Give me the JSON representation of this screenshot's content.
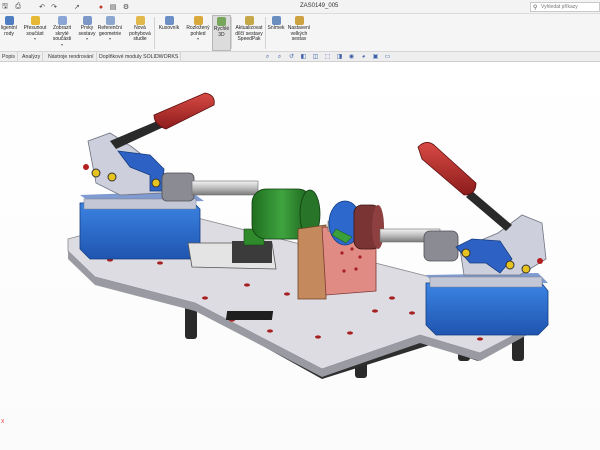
{
  "window": {
    "title": "ZAS0149_005",
    "search_placeholder": "Vyhledat příkazy"
  },
  "quick_access": [
    {
      "name": "save-icon",
      "glyph": "🖫"
    },
    {
      "name": "print-icon",
      "glyph": "⎙"
    },
    {
      "name": "undo-icon",
      "glyph": "↶"
    },
    {
      "name": "redo-icon",
      "glyph": "↷"
    },
    {
      "name": "select-arrow-icon",
      "glyph": "➚"
    },
    {
      "name": "rebuild-icon",
      "glyph": "●"
    },
    {
      "name": "file-properties-icon",
      "glyph": "▤"
    },
    {
      "name": "options-gear-icon",
      "glyph": "⚙"
    }
  ],
  "ribbon": {
    "buttons": [
      {
        "id": "smart-fasteners",
        "label": "ligentní\nrody",
        "icon_color": "#4f7fc0"
      },
      {
        "id": "move-component",
        "label": "Přesunout\nsoučást",
        "icon_color": "#e7b833"
      },
      {
        "id": "show-hidden",
        "label": "Zobrazit\nskryté\nsoučásti",
        "icon_color": "#8aa6d6"
      },
      {
        "id": "assembly-features",
        "label": "Prvky\nsestavy",
        "icon_color": "#7d98c8"
      },
      {
        "id": "reference-geometry",
        "label": "Referenční\ngeometrie",
        "icon_color": "#8da7d1"
      },
      {
        "id": "new-motion-study",
        "label": "Nová\npohybová\nstudie",
        "icon_color": "#e1b84a"
      },
      {
        "id": "bill-of-materials",
        "label": "Kusovník",
        "icon_color": "#6c8fc6"
      },
      {
        "id": "exploded-view",
        "label": "Rozložený\npohled",
        "icon_color": "#d9a93c"
      },
      {
        "id": "instant-3d",
        "label": "Rychlé\n3D",
        "icon_color": "#77a55a"
      },
      {
        "id": "update-speedpak",
        "label": "Aktualizovat\ndílčí sestavy\nSpeedPak",
        "icon_color": "#c7a848"
      },
      {
        "id": "snapshot",
        "label": "Snímek",
        "icon_color": "#6a8fbf"
      },
      {
        "id": "large-assembly-settings",
        "label": "Nastavení\nvelkých\nsestav",
        "icon_color": "#cda240"
      }
    ]
  },
  "tabs": [
    {
      "id": "tab-sketch",
      "label": "Popis"
    },
    {
      "id": "tab-evaluate",
      "label": "Analýzy"
    },
    {
      "id": "tab-render-tools",
      "label": "Nástroje rendrování"
    },
    {
      "id": "tab-addins",
      "label": "Doplňkové moduly SOLIDWORKS"
    }
  ],
  "view_toolbar": [
    {
      "name": "zoom-to-fit-icon",
      "glyph": "⌕"
    },
    {
      "name": "zoom-to-area-icon",
      "glyph": "⌕"
    },
    {
      "name": "previous-view-icon",
      "glyph": "↺"
    },
    {
      "name": "section-view-icon",
      "glyph": "◧"
    },
    {
      "name": "dynamic-annotation-icon",
      "glyph": "◫"
    },
    {
      "name": "view-orientation-icon",
      "glyph": "⬚"
    },
    {
      "name": "display-style-icon",
      "glyph": "◨"
    },
    {
      "name": "hide-show-items-icon",
      "glyph": "◉"
    },
    {
      "name": "edit-appearance-icon",
      "glyph": "◕"
    },
    {
      "name": "apply-scene-icon",
      "glyph": "▣"
    },
    {
      "name": "view-settings-icon",
      "glyph": "▭"
    }
  ],
  "colors": {
    "handle_red": "#b32828",
    "clamp_blue": "#2f6fd0",
    "green_part": "#2f8a2f",
    "plate_gray": "#d6d6dc",
    "base_dark": "#2b2b2b",
    "salmon_block": "#e08a84",
    "wood_block": "#c98a5e"
  },
  "triad": {
    "axis_label": "X"
  }
}
